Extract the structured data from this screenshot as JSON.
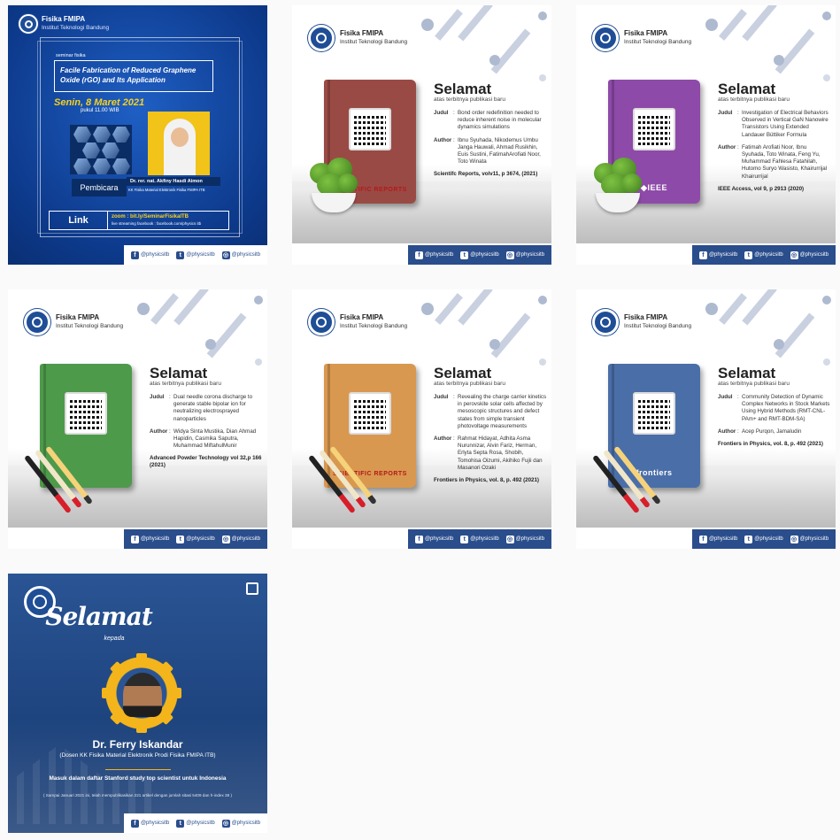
{
  "social": {
    "handle": "@physicsitb",
    "fb": "f",
    "tw": "t",
    "ig": "◎"
  },
  "org": {
    "name": "Fisika FMIPA",
    "inst": "Institut Teknologi Bandung"
  },
  "seminar": {
    "tag": "seminar fisika",
    "title": "Facile Fabrication of Reduced Graphene Oxide (rGO) and Its Application",
    "date": "Senin, 8 Maret 2021",
    "time": "pukul 11.00 WIB",
    "speaker_label": "Pembicara",
    "speaker": "Dr. rer. nat. Akfiny Hasdi Aimon",
    "affiliation": "KK Fisika Material Elektronik Fisika FMIPA ITB",
    "link_label": "Link",
    "zoom": "zoom : bit.ly/SeminarFisikaITB",
    "stream": "live streaming facebook : facebook.com/physics itb"
  },
  "pubs": [
    {
      "heading": "Selamat",
      "sub": "atas terbitnya publikasi baru",
      "judul_label": "Judul",
      "author_label": "Author",
      "title": "Bond order redefinition needed to reduce inherent noise in molecular dynamics simulations",
      "authors": "Ibnu Syuhada, Nikodemus Umbu Janga Hauwali, Ahmad Rusikhin, Euis Sustini, FatimahArofiati Noor, Toto Winata",
      "journal": "Scientifc Reports, volv11, p 3674, (2021)",
      "book_color": "#9a4a45",
      "brand": "SCIENTIFIC REPORTS"
    },
    {
      "heading": "Selamat",
      "sub": "atas terbitnya publikasi baru",
      "judul_label": "Judul",
      "author_label": "Author",
      "title": "Investigation of Electrical Behaviors Observed in Vertical GaN Nanowire Transistors Using Extended Landauer Büttiker Formula",
      "authors": "Fatimah Arofiati Noor, Ibnu Syuhada, Toto Winata, Feng Yu, Muhammad Fahlesa Fatahilah, Hutomo Suryo Wasisto, Khairurrijal Khairurrijal",
      "journal": "IEEE Access, vol 9, p 2913 (2020)",
      "book_color": "#8e4aa8",
      "brand": "◆IEEE"
    },
    {
      "heading": "Selamat",
      "sub": "atas terbitnya publikasi baru",
      "judul_label": "Judul",
      "author_label": "Author",
      "title": "Dual needle corona discharge to generate stable bipolar ion for neutralizing electrosprayed nanoparticles",
      "authors": "Widya Sinta Mustika, Dian Ahmad Hapidin, Casmika Saputra, Muhammad MiftahulMunir",
      "journal": "Advanced Powder Technology vol 32,p 166 (2021)",
      "book_color": "#4d9a4a",
      "brand": ""
    },
    {
      "heading": "Selamat",
      "sub": "atas terbitnya publikasi baru",
      "judul_label": "Judul",
      "author_label": "Author",
      "title": "Revealing the charge carrier kinetics in perovskite solar cells affected by mesoscopic structures and defect states from simple transient photovoltage measurements",
      "authors": "Rahmat Hidayat, Adhita Asma Nurunnizar, Alvin Fariz, Herman, Erlyta Septa Rosa, Shobih, Tomohisa Oizumi, Akihiko Fujii dan Masanori Ozaki",
      "journal": "Frontiers in Physics, vol. 8, p. 492 (2021)",
      "book_color": "#d9984f",
      "brand": "SCIENTIFIC REPORTS"
    },
    {
      "heading": "Selamat",
      "sub": "atas terbitnya publikasi baru",
      "judul_label": "Judul",
      "author_label": "Author",
      "title": "Community Detection of Dynamic Complex Networks in Stock Markets Using Hybrid Methods (RMT-CNL-PAm+ and RMT-BDM-SA)",
      "authors": "Acep Purqon, Jamaludin",
      "journal": "Frontiers in Physics, vol. 8, p. 492 (2021)",
      "book_color": "#4a6ea8",
      "brand": "frontiers"
    }
  ],
  "congrats": {
    "heading": "Selamat",
    "kepada": "kepada",
    "name": "Dr. Ferry Iskandar",
    "affiliation": "(Dosen KK Fisika Material Elektronik Prodi Fisika FMIPA ITB)",
    "message": "Masuk dalam daftar Stanford study top scientist untuk Indonesia",
    "note": "( Sampai Januari 2021 ini, telah mempublikasikan 221 artikel dengan jumlah sitasi 5409 dan h-index 38 )"
  }
}
